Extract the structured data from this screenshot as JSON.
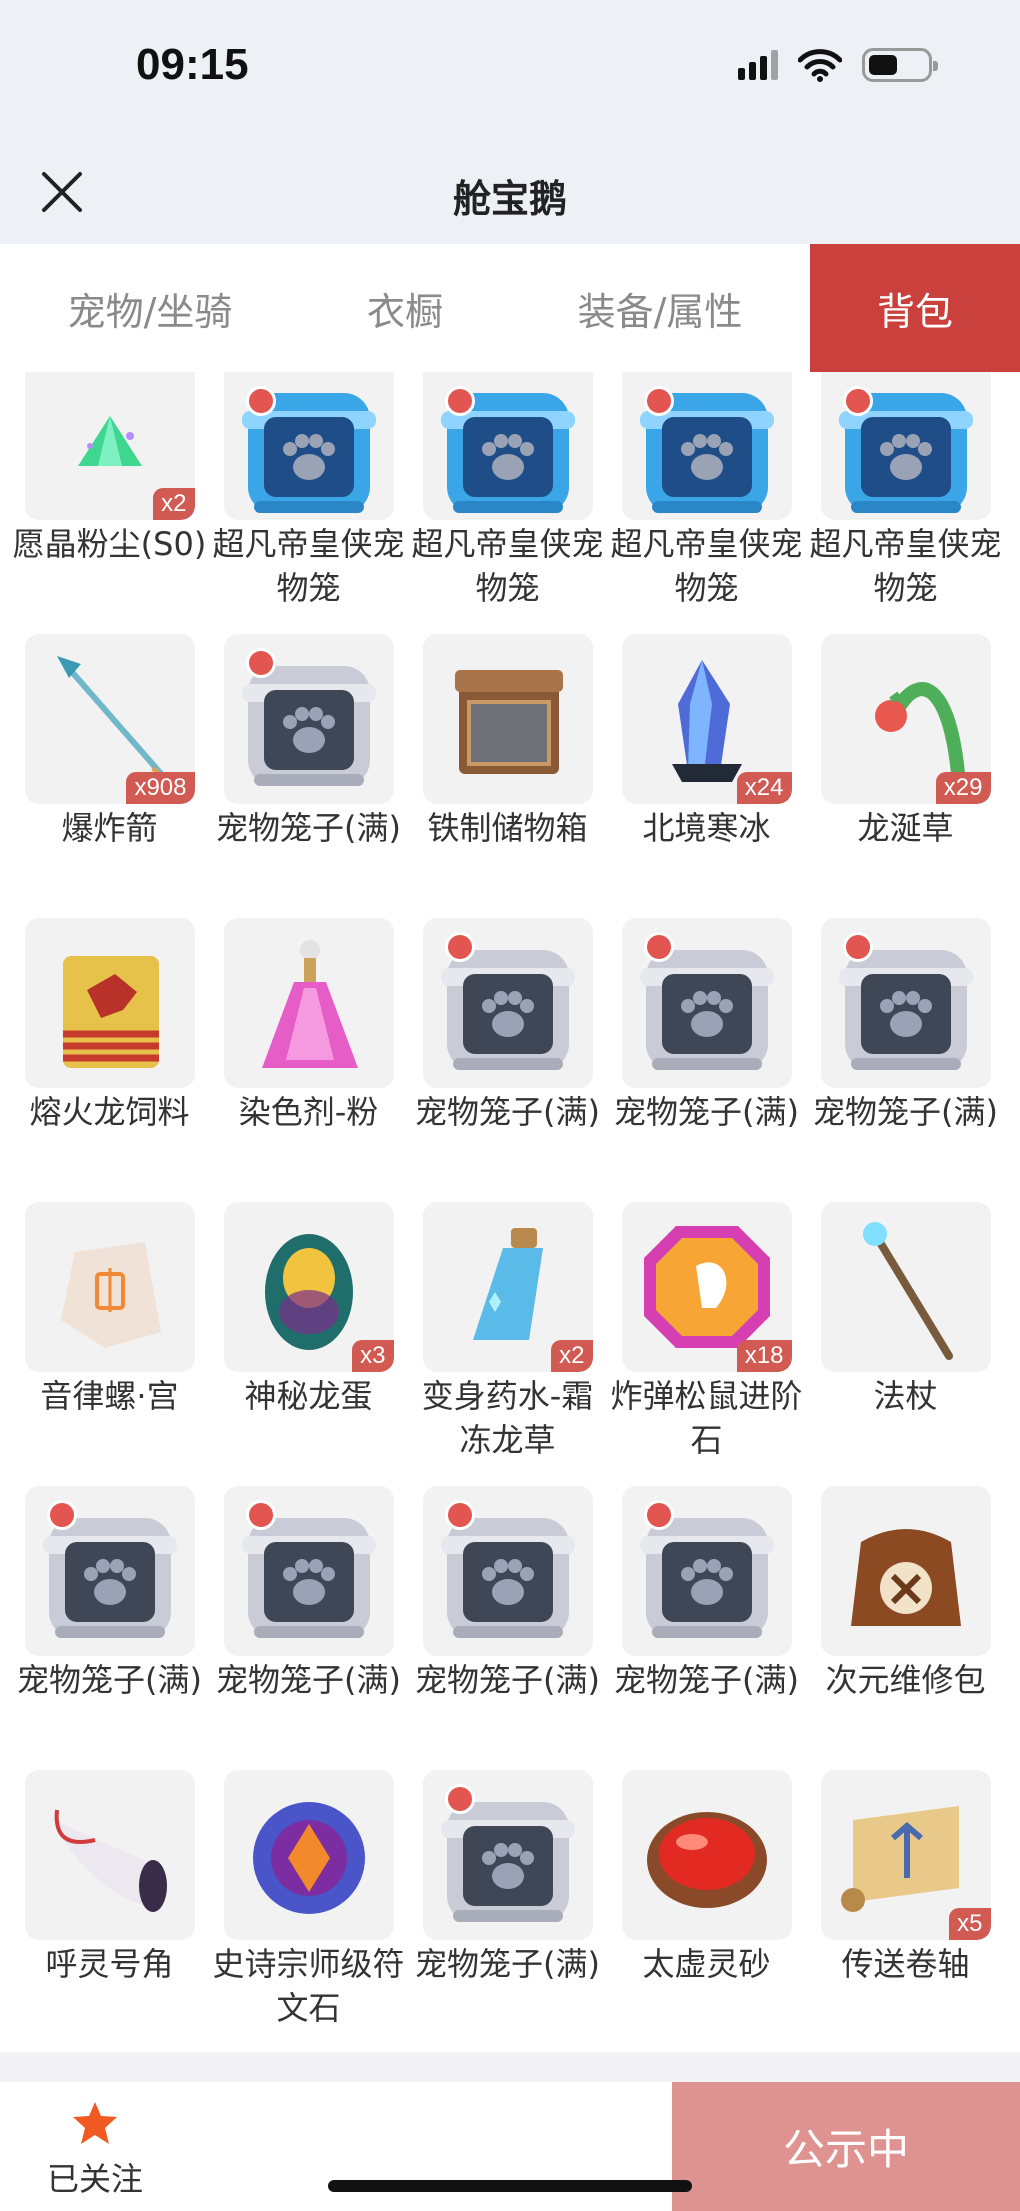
{
  "status_bar": {
    "time": "09:15"
  },
  "header": {
    "title": "舱宝鹅"
  },
  "tabs": [
    {
      "label": "宠物/坐骑",
      "active": false
    },
    {
      "label": "衣橱",
      "active": false
    },
    {
      "label": "装备/属性",
      "active": false
    },
    {
      "label": "背包",
      "active": true
    }
  ],
  "items": [
    {
      "name": "愿晶粉尘(S0)",
      "count": "x2",
      "icon": "crystal-dust-icon"
    },
    {
      "name": "超凡帝皇侠宠物笼",
      "count": "",
      "icon": "blue-pet-cage-icon"
    },
    {
      "name": "超凡帝皇侠宠物笼",
      "count": "",
      "icon": "blue-pet-cage-icon"
    },
    {
      "name": "超凡帝皇侠宠物笼",
      "count": "",
      "icon": "blue-pet-cage-icon"
    },
    {
      "name": "超凡帝皇侠宠物笼",
      "count": "",
      "icon": "blue-pet-cage-icon"
    },
    {
      "name": "爆炸箭",
      "count": "x908",
      "icon": "arrow-icon"
    },
    {
      "name": "宠物笼子(满)",
      "count": "",
      "icon": "pet-cage-icon"
    },
    {
      "name": "铁制储物箱",
      "count": "",
      "icon": "storage-box-icon"
    },
    {
      "name": "北境寒冰",
      "count": "x24",
      "icon": "ice-crystal-icon"
    },
    {
      "name": "龙涎草",
      "count": "x29",
      "icon": "herb-icon"
    },
    {
      "name": "熔火龙饲料",
      "count": "",
      "icon": "feed-bag-icon"
    },
    {
      "name": "染色剂-粉",
      "count": "",
      "icon": "dye-bottle-icon"
    },
    {
      "name": "宠物笼子(满)",
      "count": "",
      "icon": "pet-cage-icon"
    },
    {
      "name": "宠物笼子(满)",
      "count": "",
      "icon": "pet-cage-icon"
    },
    {
      "name": "宠物笼子(满)",
      "count": "",
      "icon": "pet-cage-icon"
    },
    {
      "name": "音律螺·宫",
      "count": "",
      "icon": "conch-icon"
    },
    {
      "name": "神秘龙蛋",
      "count": "x3",
      "icon": "dragon-egg-icon"
    },
    {
      "name": "变身药水-霜冻龙草",
      "count": "x2",
      "icon": "potion-icon"
    },
    {
      "name": "炸弹松鼠进阶石",
      "count": "x18",
      "icon": "gem-stone-icon"
    },
    {
      "name": "法杖",
      "count": "",
      "icon": "staff-icon"
    },
    {
      "name": "宠物笼子(满)",
      "count": "",
      "icon": "pet-cage-icon"
    },
    {
      "name": "宠物笼子(满)",
      "count": "",
      "icon": "pet-cage-icon"
    },
    {
      "name": "宠物笼子(满)",
      "count": "",
      "icon": "pet-cage-icon"
    },
    {
      "name": "宠物笼子(满)",
      "count": "",
      "icon": "pet-cage-icon"
    },
    {
      "name": "次元维修包",
      "count": "",
      "icon": "repair-bag-icon"
    },
    {
      "name": "呼灵号角",
      "count": "",
      "icon": "horn-icon"
    },
    {
      "name": "史诗宗师级符文石",
      "count": "",
      "icon": "rune-stone-icon"
    },
    {
      "name": "宠物笼子(满)",
      "count": "",
      "icon": "pet-cage-icon"
    },
    {
      "name": "太虚灵砂",
      "count": "",
      "icon": "red-sand-icon"
    },
    {
      "name": "传送卷轴",
      "count": "x5",
      "icon": "scroll-icon"
    }
  ],
  "bottom": {
    "follow_label": "已关注",
    "public_label": "公示中"
  },
  "colors": {
    "accent": "#c9403c",
    "badge": "#d15a53",
    "public_button": "#df9390",
    "star": "#f05a22"
  }
}
